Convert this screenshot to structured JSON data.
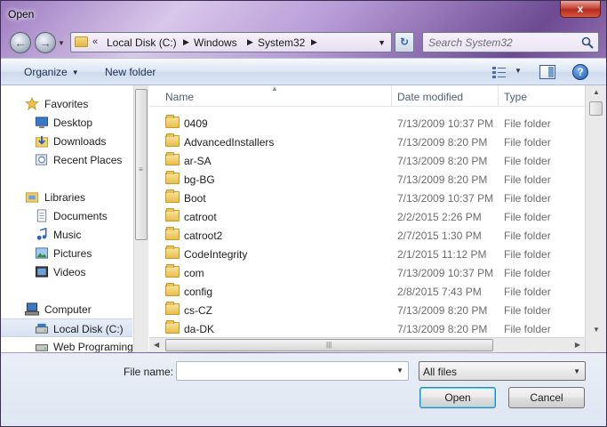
{
  "window": {
    "title": "Open",
    "close_label": "x"
  },
  "address": {
    "chevron": "«",
    "crumbs": [
      "Local Disk (C:)",
      "Windows",
      "System32"
    ]
  },
  "search": {
    "placeholder": "Search System32"
  },
  "toolbar": {
    "organize_label": "Organize",
    "new_folder_label": "New folder"
  },
  "nav_pane": {
    "items": [
      {
        "label": "Favorites",
        "icon": "star-icon"
      },
      {
        "label": "Desktop",
        "icon": "desktop-icon"
      },
      {
        "label": "Downloads",
        "icon": "downloads-icon"
      },
      {
        "label": "Recent Places",
        "icon": "recent-places-icon"
      },
      {
        "label": "Libraries",
        "icon": "libraries-icon"
      },
      {
        "label": "Documents",
        "icon": "documents-icon"
      },
      {
        "label": "Music",
        "icon": "music-icon"
      },
      {
        "label": "Pictures",
        "icon": "pictures-icon"
      },
      {
        "label": "Videos",
        "icon": "videos-icon"
      },
      {
        "label": "Computer",
        "icon": "computer-icon"
      },
      {
        "label": "Local Disk (C:)",
        "icon": "drive-icon"
      },
      {
        "label": "Web Programing",
        "icon": "drive-icon"
      }
    ],
    "selected": "Local Disk (C:)"
  },
  "columns": {
    "name": "Name",
    "date": "Date modified",
    "type": "Type"
  },
  "files": [
    {
      "name": "0409",
      "date": "7/13/2009 10:37 PM",
      "type": "File folder"
    },
    {
      "name": "AdvancedInstallers",
      "date": "7/13/2009 8:20 PM",
      "type": "File folder"
    },
    {
      "name": "ar-SA",
      "date": "7/13/2009 8:20 PM",
      "type": "File folder"
    },
    {
      "name": "bg-BG",
      "date": "7/13/2009 8:20 PM",
      "type": "File folder"
    },
    {
      "name": "Boot",
      "date": "7/13/2009 10:37 PM",
      "type": "File folder"
    },
    {
      "name": "catroot",
      "date": "2/2/2015 2:26 PM",
      "type": "File folder"
    },
    {
      "name": "catroot2",
      "date": "2/7/2015 1:30 PM",
      "type": "File folder"
    },
    {
      "name": "CodeIntegrity",
      "date": "2/1/2015 11:12 PM",
      "type": "File folder"
    },
    {
      "name": "com",
      "date": "7/13/2009 10:37 PM",
      "type": "File folder"
    },
    {
      "name": "config",
      "date": "2/8/2015 7:43 PM",
      "type": "File folder"
    },
    {
      "name": "cs-CZ",
      "date": "7/13/2009 8:20 PM",
      "type": "File folder"
    },
    {
      "name": "da-DK",
      "date": "7/13/2009 8:20 PM",
      "type": "File folder"
    }
  ],
  "bottom": {
    "file_name_label": "File name:",
    "file_name_value": "",
    "filter_value": "All files",
    "open_label": "Open",
    "cancel_label": "Cancel"
  }
}
